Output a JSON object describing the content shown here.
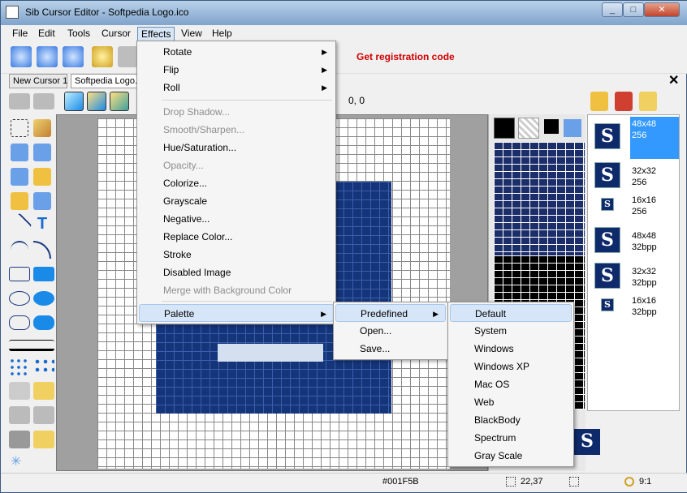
{
  "window": {
    "title": "Sib Cursor Editor - Softpedia Logo.ico"
  },
  "menubar": [
    "File",
    "Edit",
    "Tools",
    "Cursor",
    "Effects",
    "View",
    "Help"
  ],
  "toolbar": {
    "registration_link": "Get registration code"
  },
  "tabs": [
    "New Cursor 1",
    "Softpedia Logo."
  ],
  "coords": "0, 0",
  "effects_menu": [
    {
      "label": "Rotate",
      "submenu": true,
      "disabled": false
    },
    {
      "label": "Flip",
      "submenu": true,
      "disabled": false
    },
    {
      "label": "Roll",
      "submenu": true,
      "disabled": false
    },
    {
      "label": "Drop Shadow...",
      "submenu": false,
      "disabled": true
    },
    {
      "label": "Smooth/Sharpen...",
      "submenu": false,
      "disabled": true
    },
    {
      "label": "Hue/Saturation...",
      "submenu": false,
      "disabled": false
    },
    {
      "label": "Opacity...",
      "submenu": false,
      "disabled": true
    },
    {
      "label": "Colorize...",
      "submenu": false,
      "disabled": false
    },
    {
      "label": "Grayscale",
      "submenu": false,
      "disabled": false
    },
    {
      "label": "Negative...",
      "submenu": false,
      "disabled": false
    },
    {
      "label": "Replace Color...",
      "submenu": false,
      "disabled": false
    },
    {
      "label": "Stroke",
      "submenu": false,
      "disabled": false
    },
    {
      "label": "Disabled Image",
      "submenu": false,
      "disabled": false
    },
    {
      "label": "Merge with Background Color",
      "submenu": false,
      "disabled": true
    },
    {
      "label": "Palette",
      "submenu": true,
      "disabled": false,
      "highlighted": true
    }
  ],
  "palette_menu": [
    {
      "label": "Predefined",
      "submenu": true,
      "highlighted": true
    },
    {
      "label": "Open..."
    },
    {
      "label": "Save..."
    }
  ],
  "predefined_menu": [
    "Default",
    "System",
    "Windows",
    "Windows XP",
    "Mac OS",
    "Web",
    "BlackBody",
    "Spectrum",
    "Gray Scale"
  ],
  "formats": [
    {
      "size": "48x48",
      "depth": "256",
      "selected": true
    },
    {
      "size": "32x32",
      "depth": "256"
    },
    {
      "size": "16x16",
      "depth": "256"
    },
    {
      "size": "48x48",
      "depth": "32bpp"
    },
    {
      "size": "32x32",
      "depth": "32bpp"
    },
    {
      "size": "16x16",
      "depth": "32bpp"
    }
  ],
  "icon_glyph": "S",
  "status": {
    "color": "#001F5B",
    "position": "22,37",
    "zoom": "9:1"
  },
  "colors": {
    "accent": "#3399ff",
    "icon_bg": "#0e2a6b",
    "registration": "#d00000"
  }
}
